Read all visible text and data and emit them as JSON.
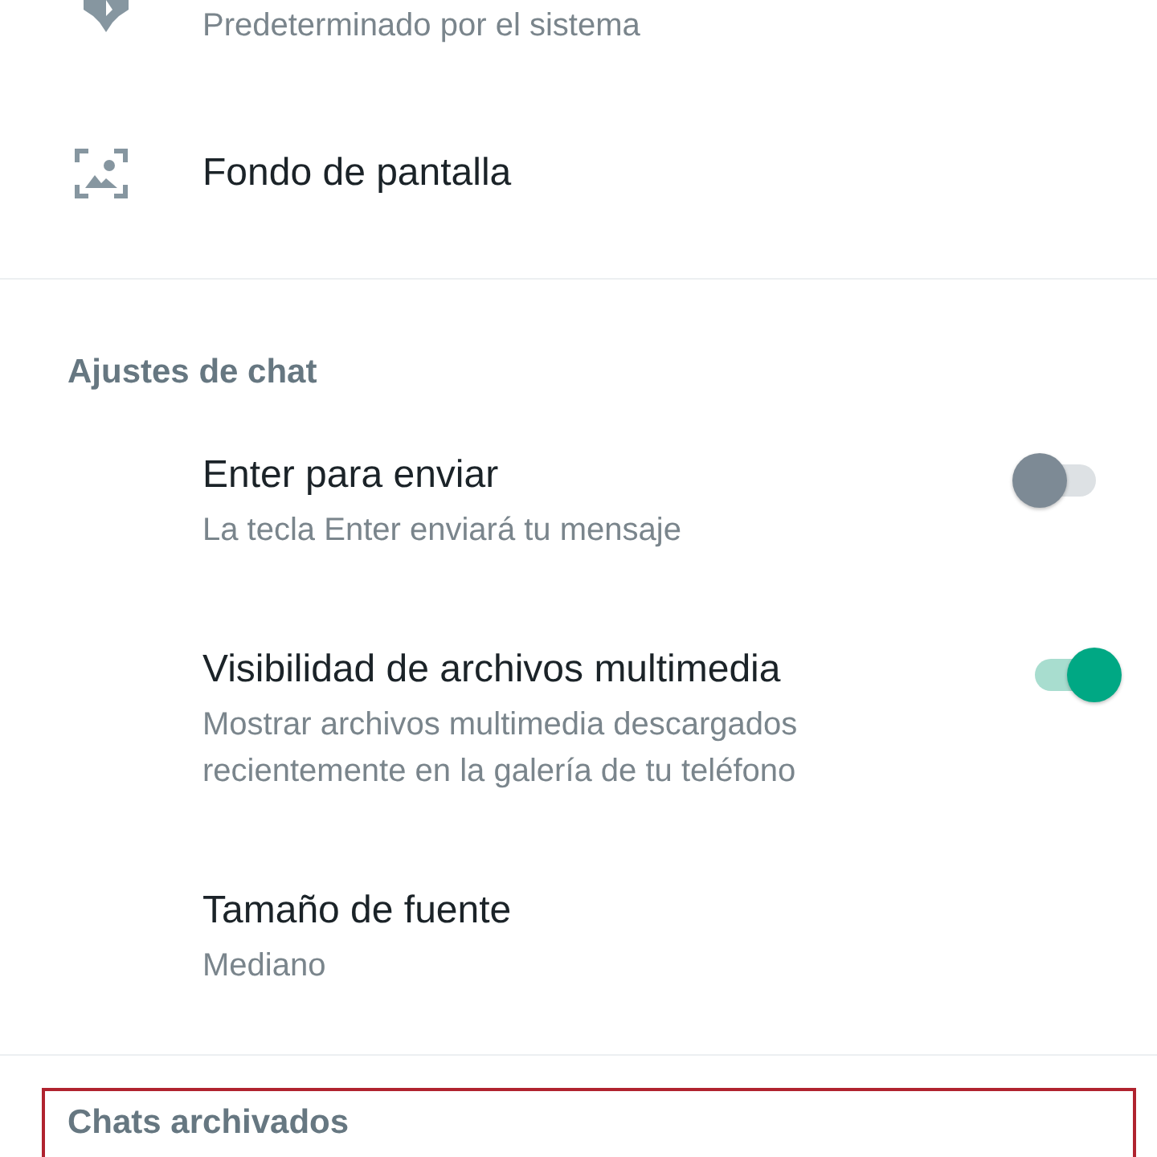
{
  "top_items": [
    {
      "kind": "theme",
      "subtitle": "Predeterminado por el sistema"
    },
    {
      "kind": "wallpaper",
      "title": "Fondo de pantalla"
    }
  ],
  "chat_settings": {
    "header": "Ajustes de chat",
    "items": [
      {
        "kind": "switch",
        "title": "Enter para enviar",
        "subtitle": "La tecla Enter enviará tu mensaje",
        "on": false
      },
      {
        "kind": "switch",
        "title": "Visibilidad de archivos multimedia",
        "subtitle": "Mostrar archivos multimedia descargados recientemente en la galería de tu teléfono",
        "on": true
      },
      {
        "kind": "value",
        "title": "Tamaño de fuente",
        "subtitle": "Mediano"
      }
    ]
  },
  "archived": {
    "header": "Chats archivados",
    "highlighted": true
  }
}
